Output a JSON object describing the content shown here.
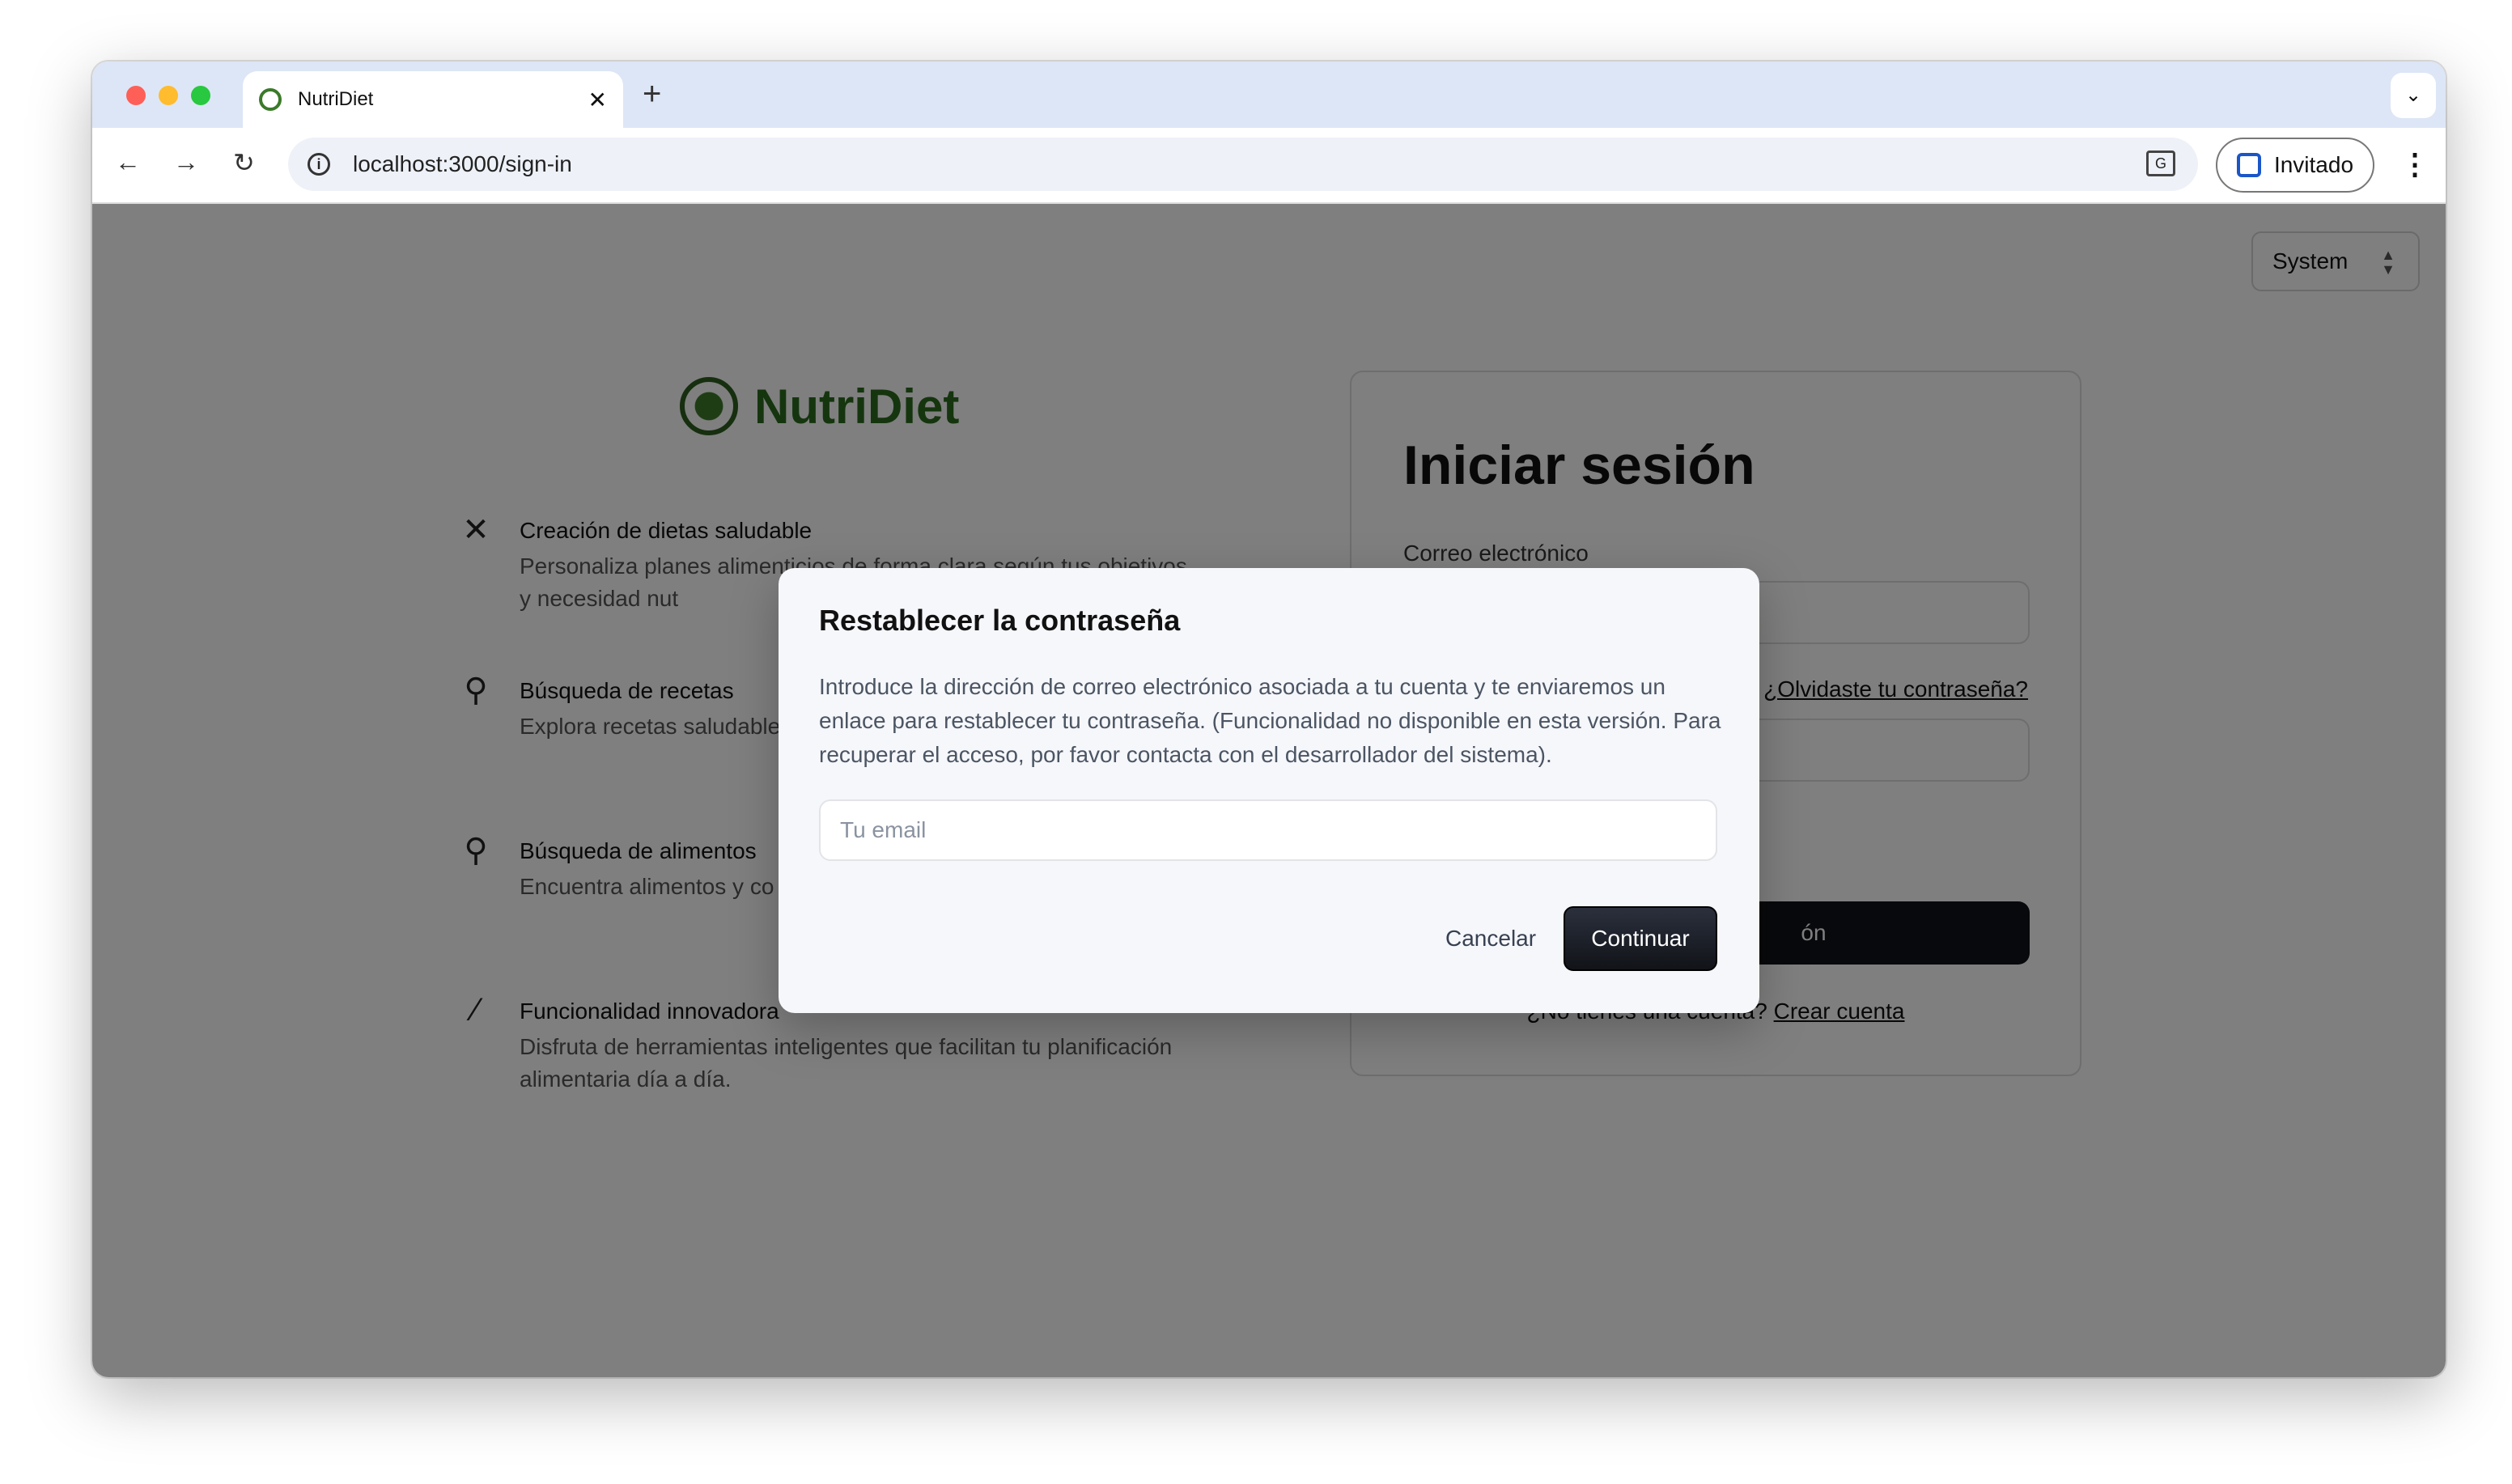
{
  "browser": {
    "tab_title": "NutriDiet",
    "url": "localhost:3000/sign-in",
    "profile_label": "Invitado"
  },
  "page": {
    "theme_select": "System",
    "brand": "NutriDiet",
    "features": [
      {
        "icon": "utensils-icon",
        "title": "Creación de dietas saludable",
        "desc": "Personaliza planes alimenticios de forma clara según tus objetivos y necesidad nut"
      },
      {
        "icon": "search-icon",
        "title": "Búsqueda de recetas",
        "desc": "Explora recetas saludable ingredientes y requerimie"
      },
      {
        "icon": "search-icon",
        "title": "Búsqueda de alimentos",
        "desc": "Encuentra alimentos y co tomar decisiones informa"
      },
      {
        "icon": "magic-wand-icon",
        "title": "Funcionalidad innovadora",
        "desc": "Disfruta de herramientas inteligentes que facilitan tu planificación alimentaria día a día."
      }
    ],
    "signin": {
      "title": "Iniciar sesión",
      "email_label": "Correo electrónico",
      "forgot_link": "¿Olvidaste tu contraseña?",
      "submit_fragment": "ón",
      "footer_text": "¿No tienes una cuenta?",
      "create_link": "Crear cuenta"
    }
  },
  "modal": {
    "title": "Restablecer la contraseña",
    "description": "Introduce la dirección de correo electrónico asociada a tu cuenta y te enviaremos un enlace para restablecer tu contraseña. (Funcionalidad no disponible en esta versión. Para recuperar el acceso, por favor contacta con el desarrollador del sistema).",
    "email_placeholder": "Tu email",
    "cancel_label": "Cancelar",
    "continue_label": "Continuar"
  }
}
